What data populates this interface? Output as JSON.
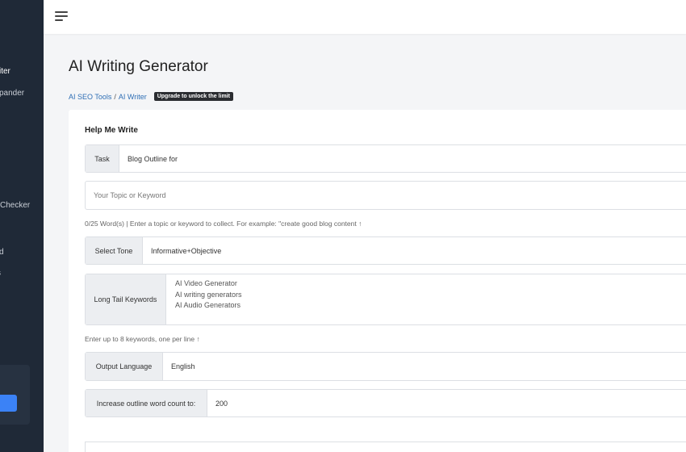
{
  "sidebar": {
    "items": [
      {
        "label": "iter",
        "active": true
      },
      {
        "label": "pander",
        "active": false
      },
      {
        "label": "Checker",
        "active": false
      },
      {
        "label": "d",
        "active": false
      },
      {
        "label": "s",
        "active": false
      }
    ]
  },
  "page": {
    "title": "AI Writing Generator"
  },
  "breadcrumb": {
    "link1": "AI SEO Tools",
    "separator": "/",
    "link2": "AI Writer",
    "badge": "Upgrade to unlock the limit"
  },
  "card": {
    "title": "Help Me Write",
    "task": {
      "label": "Task",
      "value": "Blog Outline for"
    },
    "topic": {
      "placeholder": "Your Topic or Keyword"
    },
    "topic_help": "0/25 Word(s) | Enter a topic or keyword to collect. For example: \"create good blog content ↑",
    "tone": {
      "label": "Select Tone",
      "value": "Informative+Objective"
    },
    "keywords": {
      "label": "Long Tail Keywords",
      "values": [
        "AI Video Generator",
        "AI writing generators",
        "AI Audio Generators"
      ]
    },
    "keywords_help": "Enter up to 8 keywords, one per line ↑",
    "language": {
      "label": "Output Language",
      "value": "English"
    },
    "wordcount": {
      "label": "Increase outline word count to:",
      "value": "200"
    }
  }
}
